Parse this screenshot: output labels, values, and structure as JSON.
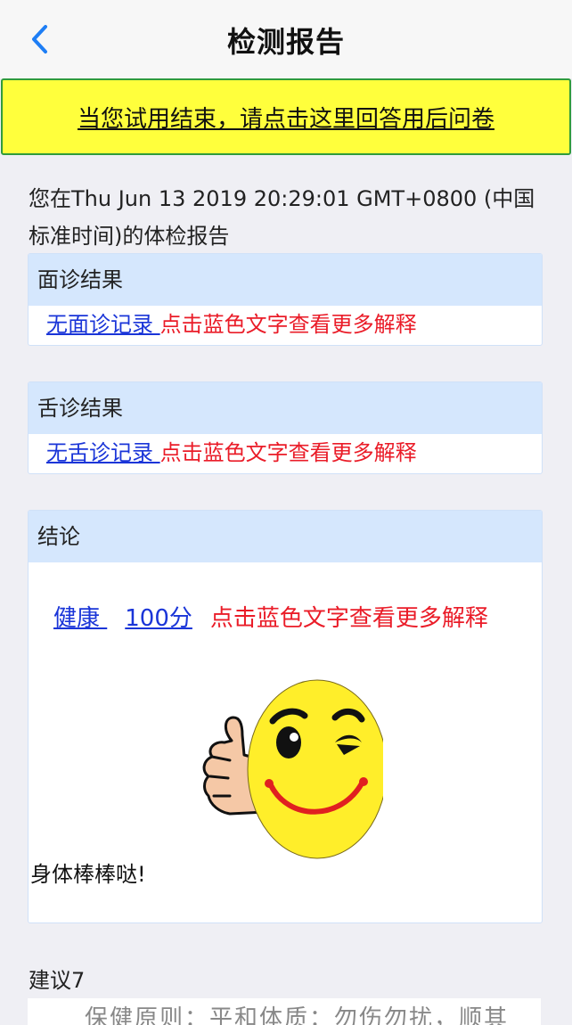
{
  "nav": {
    "title": "检测报告",
    "back_icon": "chevron-left-icon"
  },
  "banner": {
    "text": "当您试用结束，请点击这里回答用后问卷"
  },
  "intro": {
    "text": "您在Thu Jun 13 2019 20:29:01 GMT+0800 (中国标准时间)的体检报告"
  },
  "face_card": {
    "title": "面诊结果",
    "link": "无面诊记录 ",
    "hint": "点击蓝色文字查看更多解释"
  },
  "tongue_card": {
    "title": "舌诊结果",
    "link": "无舌诊记录 ",
    "hint": "点击蓝色文字查看更多解释"
  },
  "conclusion_card": {
    "title": "结论",
    "status": "健康 ",
    "score": "100分",
    "hint": "点击蓝色文字查看更多解释",
    "image_icon": "thumbs-up-smiley-icon",
    "caption": "身体棒棒哒!"
  },
  "advice": {
    "label": "建议7",
    "partial_text": "保健原则：平和体质：勿伤勿扰，顺其"
  },
  "colors": {
    "link_blue": "#1a35d8",
    "hint_red": "#ea1c28",
    "banner_yellow": "#ffff3c",
    "banner_border": "#2f9b3c",
    "card_header": "#d5e7fd",
    "back_blue": "#1e7ef5"
  }
}
